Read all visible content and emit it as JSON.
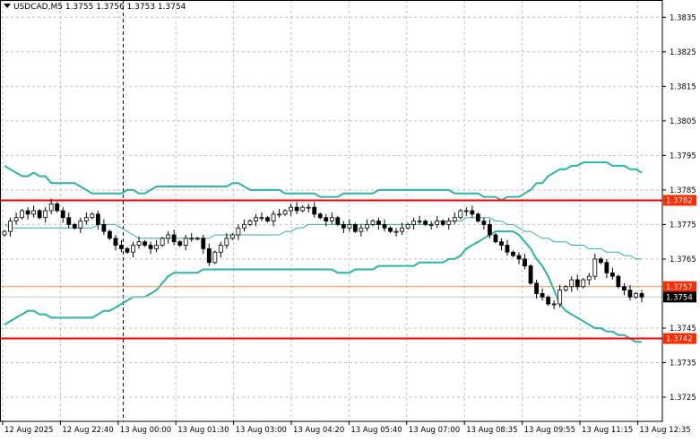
{
  "header": {
    "symbol_tf": "USDCAD,M5",
    "ohlc": "1.3755 1.3756 1.3753 1.3754"
  },
  "colors": {
    "background": "#ffffff",
    "grid": "#c0c0c0",
    "candle": "#000000",
    "bands": "#2bb5a8",
    "level_line": "#ff0000",
    "bid_line": "#ff8c4a",
    "current_label_bg": "#000000",
    "level_label_bg": "#ff2a00"
  },
  "chart_data": {
    "type": "candlestick",
    "symbol": "USDCAD",
    "timeframe": "M5",
    "ylim": [
      1.3718,
      1.384
    ],
    "y_ticks": [
      "1.3835",
      "1.3825",
      "1.3815",
      "1.3805",
      "1.3795",
      "1.3785",
      "1.3775",
      "1.3765",
      "1.3745",
      "1.3735",
      "1.3725"
    ],
    "x_tick_labels": [
      "12 Aug 2025",
      "12 Aug 22:40",
      "13 Aug 00:00",
      "13 Aug 01:30",
      "13 Aug 03:00",
      "13 Aug 04:20",
      "13 Aug 05:40",
      "13 Aug 07:00",
      "13 Aug 08:35",
      "13 Aug 09:55",
      "13 Aug 11:15",
      "13 Aug 12:35"
    ],
    "grid": true,
    "indicator": "bollinger-bands",
    "horizontal_levels": [
      {
        "value": 1.3782,
        "label": "1.3782"
      },
      {
        "value": 1.3742,
        "label": "1.3742"
      }
    ],
    "bid_level": {
      "value": 1.3757,
      "label": "1.3757"
    },
    "current_price": {
      "value": 1.3754,
      "label": "1.3754"
    },
    "period_separator_index": 20,
    "candle_count": 110,
    "series": [
      {
        "name": "Close",
        "values": [
          1.3773,
          1.3776,
          1.3777,
          1.3779,
          1.3778,
          1.3779,
          1.3777,
          1.3779,
          1.3781,
          1.3779,
          1.3777,
          1.3775,
          1.3774,
          1.3776,
          1.3777,
          1.3778,
          1.3775,
          1.3773,
          1.3771,
          1.3769,
          1.3768,
          1.3767,
          1.3769,
          1.377,
          1.3769,
          1.3768,
          1.3769,
          1.3771,
          1.3772,
          1.377,
          1.3769,
          1.3771,
          1.3771,
          1.3771,
          1.3768,
          1.3764,
          1.3767,
          1.3769,
          1.3771,
          1.3772,
          1.3774,
          1.3775,
          1.3776,
          1.3777,
          1.3777,
          1.3776,
          1.3778,
          1.3778,
          1.3779,
          1.378,
          1.3779,
          1.378,
          1.378,
          1.3778,
          1.3777,
          1.3776,
          1.3777,
          1.3775,
          1.3774,
          1.3775,
          1.3773,
          1.3774,
          1.3775,
          1.3776,
          1.3775,
          1.3774,
          1.3773,
          1.3773,
          1.3774,
          1.3775,
          1.3776,
          1.3776,
          1.3775,
          1.3775,
          1.3776,
          1.3775,
          1.3776,
          1.3777,
          1.3779,
          1.3779,
          1.3778,
          1.3776,
          1.3775,
          1.3772,
          1.377,
          1.3769,
          1.3767,
          1.3766,
          1.3765,
          1.3763,
          1.3758,
          1.3755,
          1.3754,
          1.3752,
          1.3752,
          1.3756,
          1.3757,
          1.3759,
          1.3757,
          1.3759,
          1.376,
          1.3765,
          1.3764,
          1.3761,
          1.376,
          1.3757,
          1.3756,
          1.3754,
          1.3755,
          1.3754
        ]
      },
      {
        "name": "BB Upper",
        "values": [
          1.3792,
          1.3791,
          1.379,
          1.3789,
          1.3789,
          1.379,
          1.3789,
          1.3789,
          1.3787,
          1.3787,
          1.3787,
          1.3787,
          1.3787,
          1.3786,
          1.3785,
          1.3784,
          1.3784,
          1.3784,
          1.3784,
          1.3784,
          1.3784,
          1.3785,
          1.3785,
          1.3784,
          1.3784,
          1.3785,
          1.3786,
          1.3786,
          1.3786,
          1.3786,
          1.3786,
          1.3786,
          1.3786,
          1.3786,
          1.3786,
          1.3786,
          1.3786,
          1.3786,
          1.3786,
          1.3787,
          1.3787,
          1.3786,
          1.3785,
          1.3785,
          1.3785,
          1.3785,
          1.3785,
          1.3785,
          1.3784,
          1.3784,
          1.3784,
          1.3784,
          1.3784,
          1.3784,
          1.3783,
          1.3783,
          1.3783,
          1.3783,
          1.3784,
          1.3784,
          1.3784,
          1.3784,
          1.3784,
          1.3784,
          1.3785,
          1.3785,
          1.3785,
          1.3785,
          1.3785,
          1.3785,
          1.3785,
          1.3785,
          1.3785,
          1.3785,
          1.3785,
          1.3785,
          1.3785,
          1.3784,
          1.3784,
          1.3784,
          1.3784,
          1.3784,
          1.3783,
          1.3783,
          1.3783,
          1.3782,
          1.3783,
          1.3783,
          1.3783,
          1.3784,
          1.3785,
          1.3787,
          1.3787,
          1.3789,
          1.379,
          1.3791,
          1.3791,
          1.3792,
          1.3792,
          1.3793,
          1.3793,
          1.3793,
          1.3793,
          1.3793,
          1.3792,
          1.3792,
          1.3792,
          1.3791,
          1.3791,
          1.379
        ]
      },
      {
        "name": "BB Middle",
        "values": [
          1.3775,
          1.3774,
          1.3774,
          1.3774,
          1.3774,
          1.3774,
          1.3774,
          1.3774,
          1.3774,
          1.3774,
          1.3774,
          1.3774,
          1.3774,
          1.3774,
          1.3774,
          1.3774,
          1.3775,
          1.3775,
          1.3775,
          1.3775,
          1.3774,
          1.3773,
          1.3772,
          1.3771,
          1.3771,
          1.3771,
          1.3771,
          1.3771,
          1.3771,
          1.3771,
          1.3771,
          1.3771,
          1.3771,
          1.3771,
          1.3771,
          1.3771,
          1.3772,
          1.3772,
          1.3772,
          1.3772,
          1.3772,
          1.3772,
          1.3772,
          1.3772,
          1.3772,
          1.3772,
          1.3772,
          1.3772,
          1.3773,
          1.3773,
          1.3774,
          1.3774,
          1.3775,
          1.3775,
          1.3775,
          1.3775,
          1.3775,
          1.3775,
          1.3775,
          1.3775,
          1.3775,
          1.3775,
          1.3775,
          1.3775,
          1.3775,
          1.3775,
          1.3775,
          1.3775,
          1.3775,
          1.3775,
          1.3775,
          1.3775,
          1.3775,
          1.3775,
          1.3776,
          1.3776,
          1.3776,
          1.3776,
          1.3776,
          1.3777,
          1.3777,
          1.3777,
          1.3777,
          1.3777,
          1.3776,
          1.3776,
          1.3775,
          1.3775,
          1.3774,
          1.3773,
          1.3773,
          1.3772,
          1.3771,
          1.3771,
          1.377,
          1.377,
          1.377,
          1.3769,
          1.3769,
          1.3769,
          1.3768,
          1.3768,
          1.3768,
          1.3767,
          1.3767,
          1.3767,
          1.3766,
          1.3766,
          1.3765,
          1.3765
        ]
      },
      {
        "name": "BB Lower",
        "values": [
          1.3746,
          1.3747,
          1.3748,
          1.3749,
          1.375,
          1.375,
          1.3749,
          1.3749,
          1.3748,
          1.3748,
          1.3748,
          1.3748,
          1.3748,
          1.3748,
          1.3748,
          1.3748,
          1.3749,
          1.375,
          1.375,
          1.3751,
          1.3752,
          1.3753,
          1.3754,
          1.3754,
          1.3754,
          1.3755,
          1.3756,
          1.3758,
          1.376,
          1.3761,
          1.3761,
          1.3761,
          1.3761,
          1.3761,
          1.3762,
          1.3762,
          1.3762,
          1.3762,
          1.3762,
          1.3762,
          1.3762,
          1.3762,
          1.3762,
          1.3762,
          1.3762,
          1.3762,
          1.3762,
          1.3762,
          1.3762,
          1.3762,
          1.3762,
          1.3762,
          1.3762,
          1.3762,
          1.3762,
          1.3762,
          1.3762,
          1.3761,
          1.3761,
          1.3761,
          1.3762,
          1.3762,
          1.3762,
          1.3762,
          1.3763,
          1.3763,
          1.3763,
          1.3763,
          1.3763,
          1.3763,
          1.3763,
          1.3764,
          1.3764,
          1.3764,
          1.3764,
          1.3764,
          1.3765,
          1.3765,
          1.3766,
          1.3768,
          1.3769,
          1.377,
          1.3771,
          1.3772,
          1.3773,
          1.3773,
          1.3773,
          1.3773,
          1.3772,
          1.377,
          1.3768,
          1.3765,
          1.3763,
          1.376,
          1.3756,
          1.3752,
          1.375,
          1.3749,
          1.3748,
          1.3747,
          1.3746,
          1.3745,
          1.3745,
          1.3744,
          1.3744,
          1.3743,
          1.3743,
          1.3742,
          1.3741,
          1.3741
        ]
      }
    ]
  }
}
